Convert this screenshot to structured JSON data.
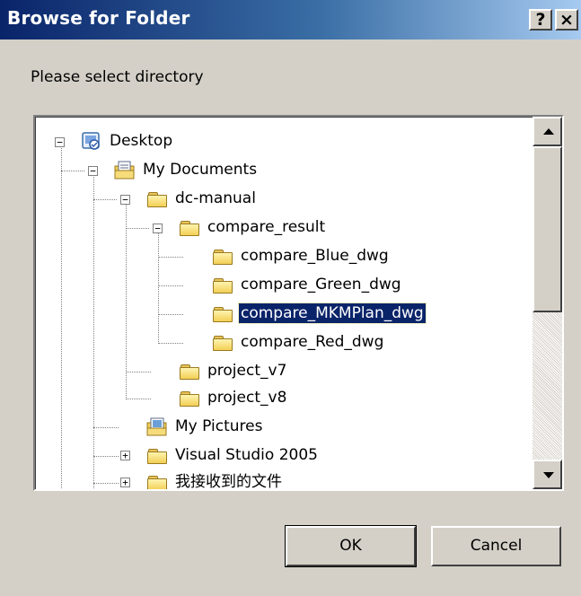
{
  "window": {
    "title": "Browse for Folder",
    "help_label": "?",
    "close_label": "×"
  },
  "prompt": "Please select directory",
  "tree": {
    "expander_collapse": "−",
    "expander_expand": "+",
    "nodes": [
      {
        "label": "Desktop",
        "icon": "desktop-icon"
      },
      {
        "label": "My Documents",
        "icon": "documents-folder-icon"
      },
      {
        "label": "dc-manual",
        "icon": "folder-icon"
      },
      {
        "label": "compare_result",
        "icon": "folder-icon"
      },
      {
        "label": "compare_Blue_dwg",
        "icon": "folder-icon"
      },
      {
        "label": "compare_Green_dwg",
        "icon": "folder-icon"
      },
      {
        "label": "compare_MKMPlan_dwg",
        "icon": "folder-icon",
        "selected": true
      },
      {
        "label": "compare_Red_dwg",
        "icon": "folder-icon"
      },
      {
        "label": "project_v7",
        "icon": "folder-icon"
      },
      {
        "label": "project_v8",
        "icon": "folder-icon"
      },
      {
        "label": "My Pictures",
        "icon": "pictures-folder-icon"
      },
      {
        "label": "Visual Studio 2005",
        "icon": "folder-icon"
      },
      {
        "label": "我接收到的文件",
        "icon": "folder-icon"
      }
    ]
  },
  "buttons": {
    "ok": "OK",
    "cancel": "Cancel"
  },
  "colors": {
    "title_start": "#0a246a",
    "title_end": "#a6caf0",
    "selection": "#0a246a",
    "face": "#d4d0c8"
  }
}
